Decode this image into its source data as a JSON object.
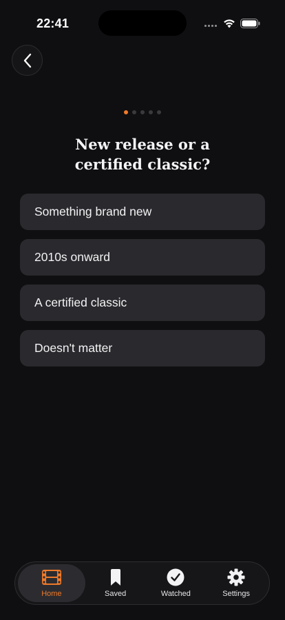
{
  "status_bar": {
    "time": "22:41"
  },
  "question": {
    "title_line1": "New release or a",
    "title_line2": "certified classic?"
  },
  "progress": {
    "current": 1,
    "total": 5
  },
  "options": [
    {
      "label": "Something brand new"
    },
    {
      "label": "2010s onward"
    },
    {
      "label": "A certified classic"
    },
    {
      "label": "Doesn't matter"
    }
  ],
  "tabs": [
    {
      "label": "Home",
      "icon": "film-icon",
      "active": true
    },
    {
      "label": "Saved",
      "icon": "bookmark-icon",
      "active": false
    },
    {
      "label": "Watched",
      "icon": "checkmark-circle-icon",
      "active": false
    },
    {
      "label": "Settings",
      "icon": "gear-icon",
      "active": false
    }
  ],
  "colors": {
    "accent": "#f07a2a",
    "background": "#0f0f11",
    "option_bg": "#2a2a2e"
  }
}
